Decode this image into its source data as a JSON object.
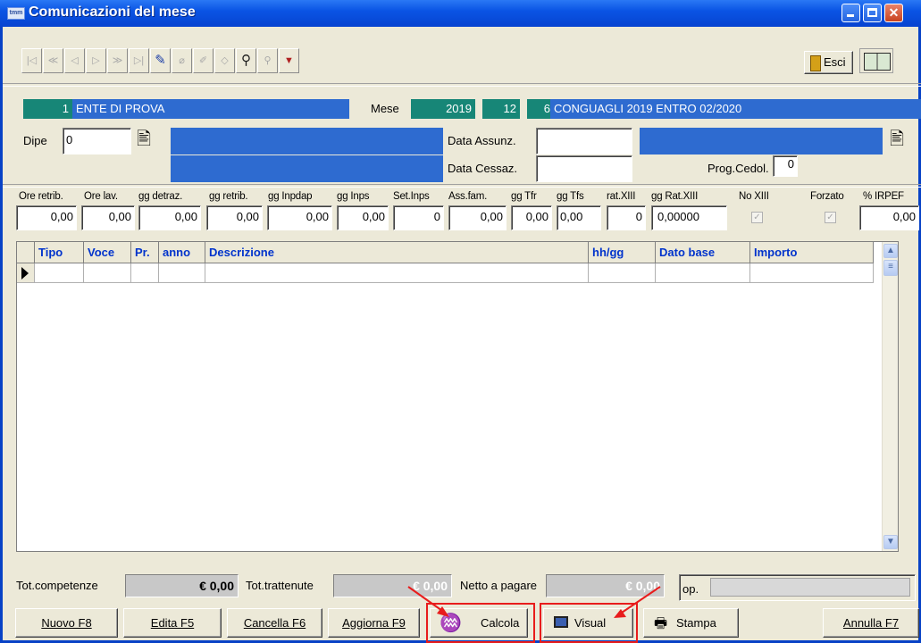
{
  "window": {
    "title": "Comunicazioni del mese",
    "app_icon_text": "tmm"
  },
  "toolbar": {
    "exit_label": "Esci"
  },
  "header": {
    "ente_code": "1",
    "ente_name": "ENTE DI PROVA",
    "mese_label": "Mese",
    "year": "2019",
    "month": "12",
    "period_code": "6",
    "period_desc": "CONGUAGLI 2019 ENTRO 02/2020",
    "dipe_label": "Dipe",
    "dipe_value": "0",
    "data_assunz_label": "Data Assunz.",
    "data_cessaz_label": "Data Cessaz.",
    "prog_cedol_label": "Prog.Cedol.",
    "prog_cedol_value": "0"
  },
  "fields": [
    {
      "label": "Ore retrib.",
      "value": "0,00"
    },
    {
      "label": "Ore lav.",
      "value": "0,00"
    },
    {
      "label": "gg detraz.",
      "value": "0,00"
    },
    {
      "label": "gg retrib.",
      "value": "0,00"
    },
    {
      "label": "gg Inpdap",
      "value": "0,00"
    },
    {
      "label": "gg Inps",
      "value": "0,00"
    },
    {
      "label": "Set.Inps",
      "value": "0"
    },
    {
      "label": "Ass.fam.",
      "value": "0,00"
    },
    {
      "label": "gg Tfr",
      "value": "0,00"
    },
    {
      "label": "gg Tfs",
      "value": "0,00"
    },
    {
      "label": "rat.XIII",
      "value": "0"
    },
    {
      "label": "gg Rat.XIII",
      "value": "0,00000"
    },
    {
      "label": "No XIII",
      "value": "checked"
    },
    {
      "label": "Forzato",
      "value": "checked"
    },
    {
      "label": "% IRPEF",
      "value": "0,00"
    }
  ],
  "grid": {
    "columns": [
      "Tipo",
      "Voce",
      "Pr.",
      "anno",
      "Descrizione",
      "hh/gg",
      "Dato base",
      "Importo"
    ]
  },
  "totals": {
    "competenze_label": "Tot.competenze",
    "competenze_value": "€ 0,00",
    "trattenute_label": "Tot.trattenute",
    "trattenute_value": "€ 0,00",
    "netto_label": "Netto a pagare",
    "netto_value": "€ 0,00",
    "op_label": "op."
  },
  "buttons": {
    "nuovo": "Nuovo F8",
    "edita": "Edita F5",
    "cancella": "Cancella F6",
    "aggiorna": "Aggiorna F9",
    "calcola": "Calcola",
    "visual": "Visual",
    "stampa": "Stampa",
    "annulla": "Annulla F7"
  }
}
